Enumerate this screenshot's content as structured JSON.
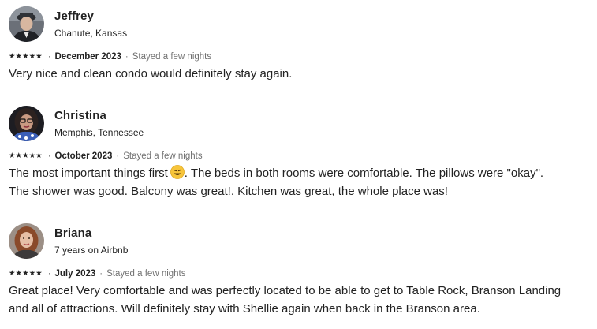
{
  "reviews": [
    {
      "name": "Jeffrey",
      "subtitle": "Chanute, Kansas",
      "rating": 5,
      "date": "December 2023",
      "stay": "Stayed a few nights",
      "text": "Very nice and clean condo would definitely stay again."
    },
    {
      "name": "Christina",
      "subtitle": "Memphis, Tennessee",
      "rating": 5,
      "date": "October 2023",
      "stay": "Stayed a few nights",
      "text_part1": "The most important things first",
      "emoji": "grinning-face-emoji",
      "text_part2": ".  The beds in both rooms were comfortable. The pillows were \"okay\".",
      "text_line2": "The shower was good.  Balcony was great!.  Kitchen was great, the whole place was!"
    },
    {
      "name": "Briana",
      "subtitle": "7 years on Airbnb",
      "rating": 5,
      "date": "July 2023",
      "stay": "Stayed a few nights",
      "text_line1": "Great place! Very comfortable and was perfectly located to be able to get to Table Rock, Branson Landing",
      "text_line2": "and all of attractions. Will definitely stay with Shellie again when back in the Branson area."
    }
  ],
  "icons": {
    "star": "★",
    "separator": "·"
  }
}
